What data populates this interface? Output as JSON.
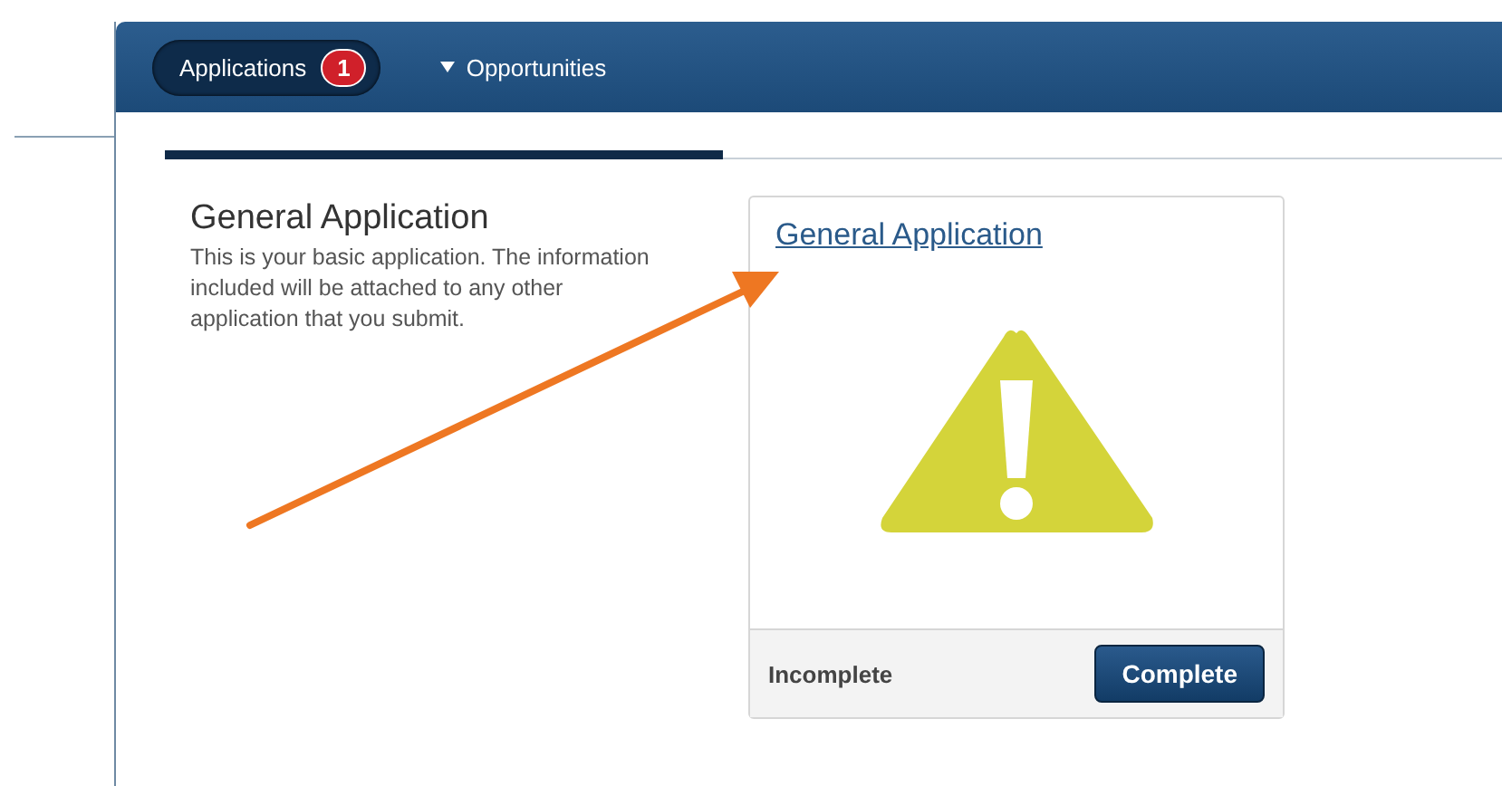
{
  "nav": {
    "tabs": [
      {
        "label": "Applications",
        "selected": true,
        "badge": "1",
        "dropdown": false
      },
      {
        "label": "Opportunities",
        "selected": false,
        "dropdown": true
      }
    ]
  },
  "intro": {
    "title": "General Application",
    "description": "This is your basic application. The information included will be attached to any other application that you submit."
  },
  "card": {
    "title": "General Application",
    "status": "Incomplete",
    "warning": true,
    "button": "Complete"
  }
}
